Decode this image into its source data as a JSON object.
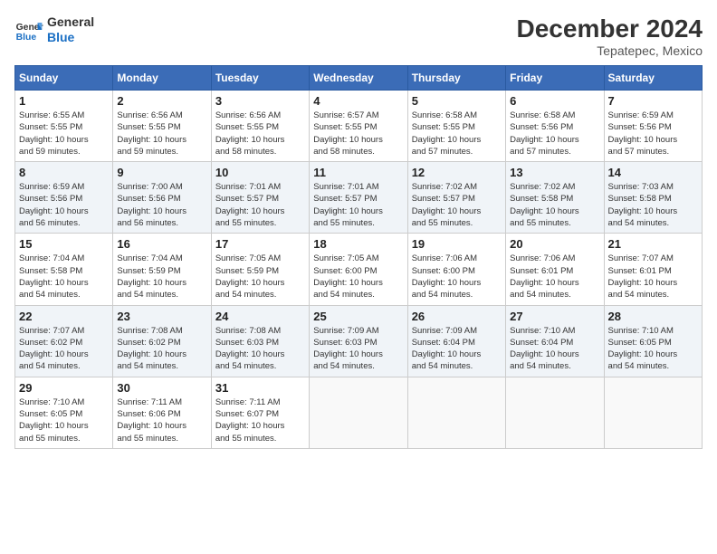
{
  "logo": {
    "line1": "General",
    "line2": "Blue"
  },
  "title": {
    "month_year": "December 2024",
    "location": "Tepatepec, Mexico"
  },
  "weekdays": [
    "Sunday",
    "Monday",
    "Tuesday",
    "Wednesday",
    "Thursday",
    "Friday",
    "Saturday"
  ],
  "weeks": [
    [
      {
        "day": "1",
        "info": "Sunrise: 6:55 AM\nSunset: 5:55 PM\nDaylight: 10 hours\nand 59 minutes."
      },
      {
        "day": "2",
        "info": "Sunrise: 6:56 AM\nSunset: 5:55 PM\nDaylight: 10 hours\nand 59 minutes."
      },
      {
        "day": "3",
        "info": "Sunrise: 6:56 AM\nSunset: 5:55 PM\nDaylight: 10 hours\nand 58 minutes."
      },
      {
        "day": "4",
        "info": "Sunrise: 6:57 AM\nSunset: 5:55 PM\nDaylight: 10 hours\nand 58 minutes."
      },
      {
        "day": "5",
        "info": "Sunrise: 6:58 AM\nSunset: 5:55 PM\nDaylight: 10 hours\nand 57 minutes."
      },
      {
        "day": "6",
        "info": "Sunrise: 6:58 AM\nSunset: 5:56 PM\nDaylight: 10 hours\nand 57 minutes."
      },
      {
        "day": "7",
        "info": "Sunrise: 6:59 AM\nSunset: 5:56 PM\nDaylight: 10 hours\nand 57 minutes."
      }
    ],
    [
      {
        "day": "8",
        "info": "Sunrise: 6:59 AM\nSunset: 5:56 PM\nDaylight: 10 hours\nand 56 minutes."
      },
      {
        "day": "9",
        "info": "Sunrise: 7:00 AM\nSunset: 5:56 PM\nDaylight: 10 hours\nand 56 minutes."
      },
      {
        "day": "10",
        "info": "Sunrise: 7:01 AM\nSunset: 5:57 PM\nDaylight: 10 hours\nand 55 minutes."
      },
      {
        "day": "11",
        "info": "Sunrise: 7:01 AM\nSunset: 5:57 PM\nDaylight: 10 hours\nand 55 minutes."
      },
      {
        "day": "12",
        "info": "Sunrise: 7:02 AM\nSunset: 5:57 PM\nDaylight: 10 hours\nand 55 minutes."
      },
      {
        "day": "13",
        "info": "Sunrise: 7:02 AM\nSunset: 5:58 PM\nDaylight: 10 hours\nand 55 minutes."
      },
      {
        "day": "14",
        "info": "Sunrise: 7:03 AM\nSunset: 5:58 PM\nDaylight: 10 hours\nand 54 minutes."
      }
    ],
    [
      {
        "day": "15",
        "info": "Sunrise: 7:04 AM\nSunset: 5:58 PM\nDaylight: 10 hours\nand 54 minutes."
      },
      {
        "day": "16",
        "info": "Sunrise: 7:04 AM\nSunset: 5:59 PM\nDaylight: 10 hours\nand 54 minutes."
      },
      {
        "day": "17",
        "info": "Sunrise: 7:05 AM\nSunset: 5:59 PM\nDaylight: 10 hours\nand 54 minutes."
      },
      {
        "day": "18",
        "info": "Sunrise: 7:05 AM\nSunset: 6:00 PM\nDaylight: 10 hours\nand 54 minutes."
      },
      {
        "day": "19",
        "info": "Sunrise: 7:06 AM\nSunset: 6:00 PM\nDaylight: 10 hours\nand 54 minutes."
      },
      {
        "day": "20",
        "info": "Sunrise: 7:06 AM\nSunset: 6:01 PM\nDaylight: 10 hours\nand 54 minutes."
      },
      {
        "day": "21",
        "info": "Sunrise: 7:07 AM\nSunset: 6:01 PM\nDaylight: 10 hours\nand 54 minutes."
      }
    ],
    [
      {
        "day": "22",
        "info": "Sunrise: 7:07 AM\nSunset: 6:02 PM\nDaylight: 10 hours\nand 54 minutes."
      },
      {
        "day": "23",
        "info": "Sunrise: 7:08 AM\nSunset: 6:02 PM\nDaylight: 10 hours\nand 54 minutes."
      },
      {
        "day": "24",
        "info": "Sunrise: 7:08 AM\nSunset: 6:03 PM\nDaylight: 10 hours\nand 54 minutes."
      },
      {
        "day": "25",
        "info": "Sunrise: 7:09 AM\nSunset: 6:03 PM\nDaylight: 10 hours\nand 54 minutes."
      },
      {
        "day": "26",
        "info": "Sunrise: 7:09 AM\nSunset: 6:04 PM\nDaylight: 10 hours\nand 54 minutes."
      },
      {
        "day": "27",
        "info": "Sunrise: 7:10 AM\nSunset: 6:04 PM\nDaylight: 10 hours\nand 54 minutes."
      },
      {
        "day": "28",
        "info": "Sunrise: 7:10 AM\nSunset: 6:05 PM\nDaylight: 10 hours\nand 54 minutes."
      }
    ],
    [
      {
        "day": "29",
        "info": "Sunrise: 7:10 AM\nSunset: 6:05 PM\nDaylight: 10 hours\nand 55 minutes."
      },
      {
        "day": "30",
        "info": "Sunrise: 7:11 AM\nSunset: 6:06 PM\nDaylight: 10 hours\nand 55 minutes."
      },
      {
        "day": "31",
        "info": "Sunrise: 7:11 AM\nSunset: 6:07 PM\nDaylight: 10 hours\nand 55 minutes."
      },
      null,
      null,
      null,
      null
    ]
  ]
}
